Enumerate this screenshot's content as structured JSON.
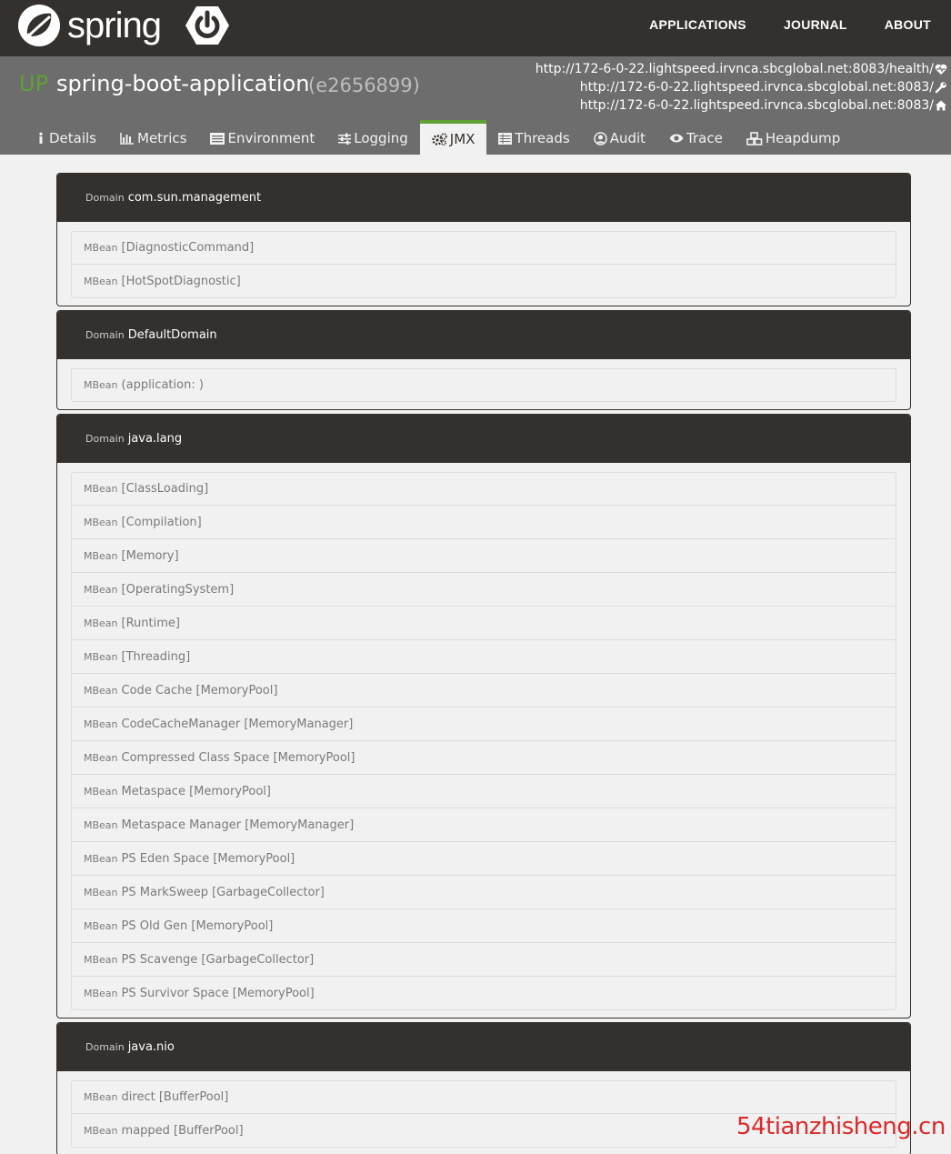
{
  "navbar": {
    "logo_text": "spring",
    "links": [
      "APPLICATIONS",
      "JOURNAL",
      "ABOUT"
    ]
  },
  "app": {
    "status": "UP",
    "name": "spring-boot-application",
    "id": "(e2656899)",
    "urls": [
      {
        "text": "http://172-6-0-22.lightspeed.irvnca.sbcglobal.net:8083/health/",
        "icon": "heartbeat-icon"
      },
      {
        "text": "http://172-6-0-22.lightspeed.irvnca.sbcglobal.net:8083/",
        "icon": "wrench-icon"
      },
      {
        "text": "http://172-6-0-22.lightspeed.irvnca.sbcglobal.net:8083/",
        "icon": "home-icon"
      }
    ]
  },
  "tabs": [
    {
      "label": "Details",
      "icon": "info-icon",
      "active": false
    },
    {
      "label": "Metrics",
      "icon": "bar-chart-icon",
      "active": false
    },
    {
      "label": "Environment",
      "icon": "list-icon",
      "active": false
    },
    {
      "label": "Logging",
      "icon": "sliders-icon",
      "active": false
    },
    {
      "label": "JMX",
      "icon": "cogs-icon",
      "active": true
    },
    {
      "label": "Threads",
      "icon": "table-icon",
      "active": false
    },
    {
      "label": "Audit",
      "icon": "user-circle-icon",
      "active": false
    },
    {
      "label": "Trace",
      "icon": "eye-icon",
      "active": false
    },
    {
      "label": "Heapdump",
      "icon": "cubes-icon",
      "active": false
    }
  ],
  "labels": {
    "domain": "Domain",
    "mbean": "MBean"
  },
  "domains": [
    {
      "name": "com.sun.management",
      "mbeans": [
        "[DiagnosticCommand]",
        "[HotSpotDiagnostic]"
      ]
    },
    {
      "name": "DefaultDomain",
      "mbeans": [
        "(application: )"
      ]
    },
    {
      "name": "java.lang",
      "mbeans": [
        "[ClassLoading]",
        "[Compilation]",
        "[Memory]",
        "[OperatingSystem]",
        "[Runtime]",
        "[Threading]",
        "Code Cache [MemoryPool]",
        "CodeCacheManager [MemoryManager]",
        "Compressed Class Space [MemoryPool]",
        "Metaspace [MemoryPool]",
        "Metaspace Manager [MemoryManager]",
        "PS Eden Space [MemoryPool]",
        "PS MarkSweep [GarbageCollector]",
        "PS Old Gen [MemoryPool]",
        "PS Scavenge [GarbageCollector]",
        "PS Survivor Space [MemoryPool]"
      ]
    },
    {
      "name": "java.nio",
      "mbeans": [
        "direct [BufferPool]",
        "mapped [BufferPool]"
      ]
    }
  ],
  "watermark": "54tianzhisheng.cn",
  "colors": {
    "navbar": "#34302d",
    "header": "#6d6d6d",
    "status_up": "#5fa134",
    "accent": "#5fa134"
  }
}
